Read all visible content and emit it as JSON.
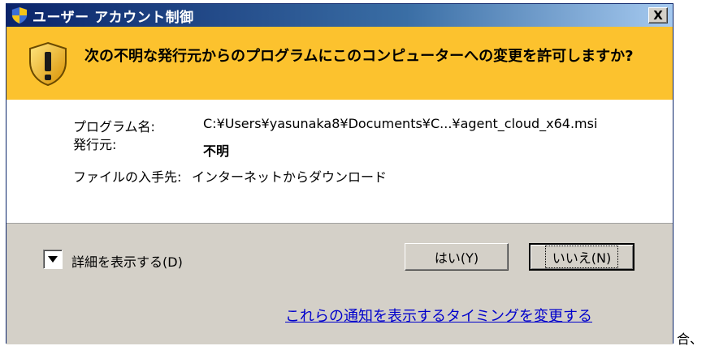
{
  "window": {
    "title": "ユーザー アカウント制御",
    "close_label": "X"
  },
  "banner": {
    "message": "次の不明な発行元からのプログラムにこのコンピューターへの変更を許可しますか?"
  },
  "details": {
    "program_label": "プログラム名:",
    "program_value": "C:¥Users¥yasunaka8¥Documents¥C...¥agent_cloud_x64.msi",
    "publisher_label": "発行元:",
    "publisher_value": "不明",
    "source_label": "ファイルの入手先:",
    "source_value": "インターネットからダウンロード"
  },
  "footer": {
    "details_toggle_label": "詳細を表示する(D)",
    "yes_label": "はい(Y)",
    "no_label": "いいえ(N)",
    "notification_link": "これらの通知を表示するタイミングを変更する"
  },
  "outside": {
    "trailing_text": "合、"
  },
  "colors": {
    "banner": "#fcc22e",
    "titlebar_start": "#0a246a",
    "titlebar_end": "#a6caf0",
    "link": "#0000cc",
    "dialog_bg": "#d4d0c8"
  }
}
